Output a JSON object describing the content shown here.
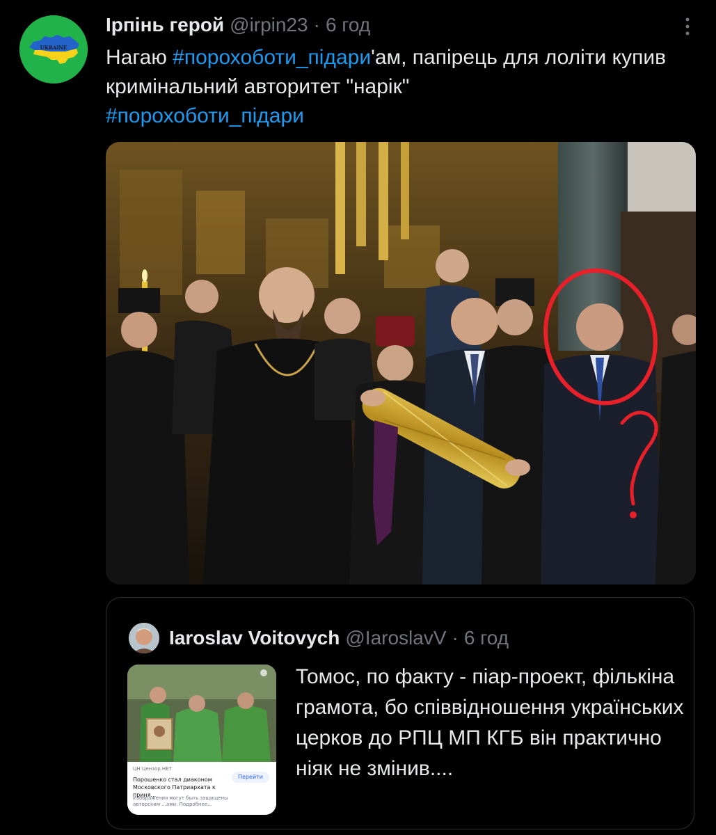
{
  "tweet": {
    "display_name": "Ірпінь герой",
    "handle": "@irpin23",
    "separator": "·",
    "time": "6 год",
    "avatar": {
      "label": "UKRAINE",
      "colors": {
        "bg": "#22b24a",
        "blue": "#2463c9",
        "yellow": "#f7d21a"
      }
    },
    "more_icon": "more-horizontal-icon",
    "text": {
      "part1": "Нагаю ",
      "hashtag1": "#порохоботи_підари",
      "part2": "'ам, папірець для лоліти купив кримінальний авторитет \"нарік\"",
      "hashtag2": "#порохоботи_підари"
    }
  },
  "quote": {
    "display_name": "Iaroslav Voitovych",
    "handle": "@IaroslavV",
    "separator": "·",
    "time": "6 год",
    "text": "Томос, по факту - піар-проект, фількіна грамота, бо співвідношення українських церков до РПЦ МП КГБ він практично ніяк не змінив....",
    "thumbnail": {
      "source": "ЦН Цензор.НЕТ",
      "goto_button": "Перейти",
      "headline": "Порошенко стал диаконом Московского Патриархата к приня...",
      "caption": "Изображения могут быть защищены авторским ...ами. Подробнее..."
    }
  },
  "colors": {
    "background": "#000000",
    "text": "#e7e9ea",
    "secondary": "#71767b",
    "accent": "#1d9bf0",
    "border": "#2f3336",
    "annotation": "#e8202a"
  }
}
